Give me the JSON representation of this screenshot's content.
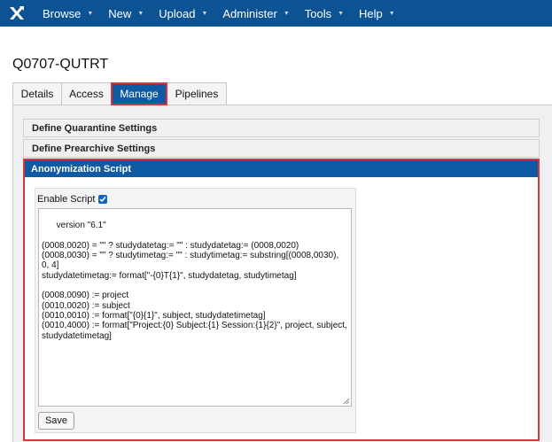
{
  "nav": {
    "logo_icon": "xnat-logo-icon",
    "items": [
      {
        "label": "Browse"
      },
      {
        "label": "New"
      },
      {
        "label": "Upload"
      },
      {
        "label": "Administer"
      },
      {
        "label": "Tools"
      },
      {
        "label": "Help"
      }
    ],
    "caret_icon": "▼"
  },
  "project": {
    "title": "Q0707-QUTRT"
  },
  "tabs": [
    {
      "label": "Details"
    },
    {
      "label": "Access"
    },
    {
      "label": "Manage"
    },
    {
      "label": "Pipelines"
    }
  ],
  "accordion": {
    "quarantine": "Define Quarantine Settings",
    "prearchive": "Define Prearchive Settings",
    "anonymization": "Anonymization Script"
  },
  "script": {
    "enable_label": "Enable Script",
    "enabled": true,
    "content": "version \"6.1\"\n\n(0008,0020) = \"\" ? studydatetag:= \"\" : studydatetag:= (0008,0020)\n(0008,0030) = \"\" ? studytimetag:= \"\" : studytimetag:= substring[(0008,0030), 0, 4]\nstudydatetimetag:= format[\"-{0}T{1}\", studydatetag, studytimetag]\n\n(0008,0090) := project\n(0010,0020) := subject\n(0010,0010) := format[\"{0}{1}\", subject, studydatetimetag]\n(0010,4000) := format[\"Project:{0} Subject:{1} Session:{1}{2}\", project, subject, studydatetimetag]",
    "save_label": "Save"
  },
  "colors": {
    "nav_bg": "#0b5393",
    "active_blue": "#0e5ba3",
    "highlight_red": "#d9343b",
    "panel_bg": "#eef0f2"
  }
}
